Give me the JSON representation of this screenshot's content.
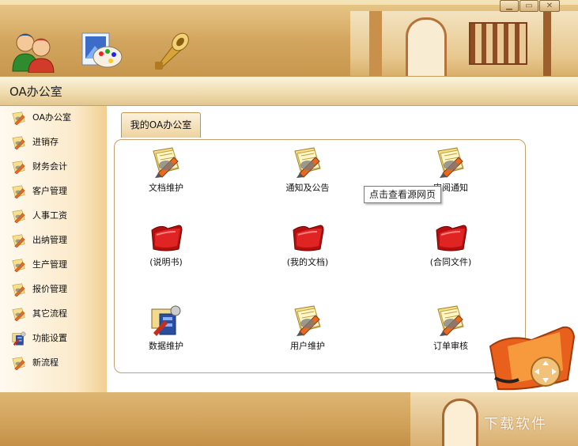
{
  "window": {
    "title": "OA办公室",
    "controls": [
      "minimize",
      "maximize",
      "close"
    ]
  },
  "toolbar": {
    "icons": [
      "users-icon",
      "paint-palette-icon",
      "horn-icon"
    ]
  },
  "sidebar": {
    "items": [
      {
        "label": "OA办公室",
        "icon": "pencil-folder-icon"
      },
      {
        "label": "进销存",
        "icon": "pencil-folder-icon"
      },
      {
        "label": "财务会计",
        "icon": "pencil-folder-icon"
      },
      {
        "label": "客户管理",
        "icon": "pencil-folder-icon"
      },
      {
        "label": "人事工资",
        "icon": "pencil-folder-icon"
      },
      {
        "label": "出纳管理",
        "icon": "pencil-folder-icon"
      },
      {
        "label": "生产管理",
        "icon": "pencil-folder-icon"
      },
      {
        "label": "报价管理",
        "icon": "pencil-folder-icon"
      },
      {
        "label": "其它流程",
        "icon": "pencil-folder-icon"
      },
      {
        "label": "功能设置",
        "icon": "tools-icon"
      },
      {
        "label": "新流程",
        "icon": "pencil-folder-icon"
      }
    ]
  },
  "main": {
    "tab_label": "我的OA办公室",
    "tiles": [
      {
        "label": "文档维护",
        "icon": "document-pen-icon"
      },
      {
        "label": "通知及公告",
        "icon": "document-pen-icon"
      },
      {
        "label": "审阅通知",
        "icon": "document-pen-icon"
      },
      {
        "label": "(说明书)",
        "icon": "red-folder-icon"
      },
      {
        "label": "(我的文档)",
        "icon": "red-folder-icon"
      },
      {
        "label": "(合同文件)",
        "icon": "red-folder-icon"
      },
      {
        "label": "数据维护",
        "icon": "tools-icon"
      },
      {
        "label": "用户维护",
        "icon": "document-pen-icon"
      },
      {
        "label": "订单审核",
        "icon": "document-pen-icon"
      }
    ],
    "tooltip": "点击查看源网页"
  },
  "footer": {
    "watermark": "下载软件"
  },
  "colors": {
    "banner": "#d2a55e",
    "panel_border": "#c4a06a",
    "sidebar_edge": "#f1cf93",
    "folder_red": "#c81010"
  }
}
